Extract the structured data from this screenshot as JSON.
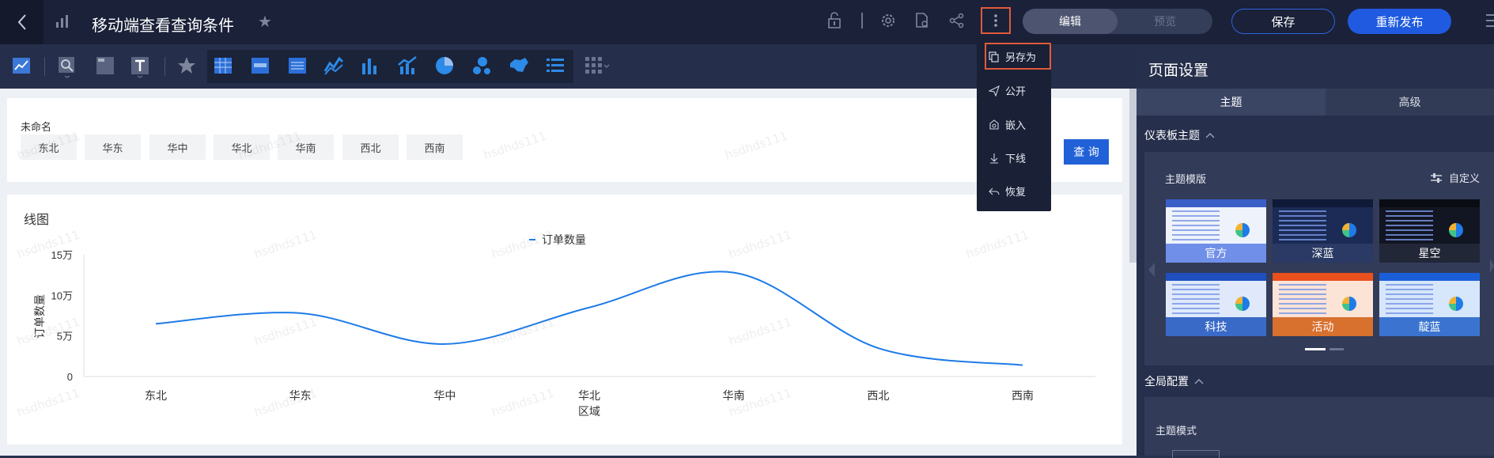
{
  "header": {
    "title": "移动端查看查询条件",
    "mode_edit": "编辑",
    "mode_preview": "预览",
    "save": "保存",
    "publish": "重新发布"
  },
  "more_menu": {
    "items": [
      {
        "label": "另存为",
        "icon": "copy-icon"
      },
      {
        "label": "公开",
        "icon": "send-icon"
      },
      {
        "label": "嵌入",
        "icon": "embed-icon"
      },
      {
        "label": "下线",
        "icon": "offline-icon"
      },
      {
        "label": "恢复",
        "icon": "restore-icon"
      }
    ]
  },
  "filter": {
    "name": "未命名",
    "options": [
      "东北",
      "华东",
      "华中",
      "华北",
      "华南",
      "西北",
      "西南"
    ],
    "query": "查 询"
  },
  "chart_data": {
    "type": "line",
    "title": "线图",
    "legend": "订单数量",
    "legend_position": "top-center",
    "xlabel": "区域",
    "ylabel": "订单数量",
    "categories": [
      "东北",
      "华东",
      "华中",
      "华北",
      "华南",
      "西北",
      "西南"
    ],
    "series": [
      {
        "name": "订单数量",
        "values": [
          65000,
          78000,
          40000,
          85000,
          128000,
          35000,
          14000
        ],
        "color": "#1e7be8"
      }
    ],
    "ylim": [
      0,
      150000
    ],
    "y_ticks": [
      0,
      50000,
      100000,
      150000
    ],
    "y_tick_labels": [
      "0",
      "5万",
      "10万",
      "15万"
    ],
    "grid": false
  },
  "settings": {
    "title": "页面设置",
    "tabs": [
      "主题",
      "高级"
    ],
    "dashboard_theme": "仪表板主题",
    "template_label": "主题模版",
    "custom": "自定义",
    "themes": [
      {
        "name": "官方",
        "bg": "#eef2fb",
        "head": "#3b5fc9",
        "band": "#6f8fe8"
      },
      {
        "name": "深蓝",
        "bg": "#1b2b55",
        "head": "#0f1a38",
        "band": "#2a3a64"
      },
      {
        "name": "星空",
        "bg": "#121522",
        "head": "#0a0c14",
        "band": "#222738"
      },
      {
        "name": "科技",
        "bg": "#dfe9fb",
        "head": "#1f4fbf",
        "band": "#3a6ac8"
      },
      {
        "name": "活动",
        "bg": "#fbe3d6",
        "head": "#e8501e",
        "band": "#d8702e"
      },
      {
        "name": "靛蓝",
        "bg": "#d6e6fb",
        "head": "#1a5fd8",
        "band": "#3a74d0"
      }
    ],
    "global_config": "全局配置",
    "theme_mode": "主题模式"
  },
  "watermark": "hsdhds111"
}
